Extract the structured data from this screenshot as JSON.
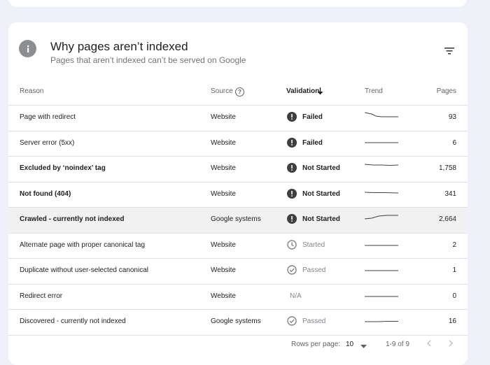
{
  "card": {
    "title": "Why pages aren’t indexed",
    "subtitle": "Pages that aren’t indexed can’t be served on Google"
  },
  "columns": {
    "reason": "Reason",
    "source": "Source",
    "validation": "Validation",
    "trend": "Trend",
    "pages": "Pages"
  },
  "rows": [
    {
      "reason": "Page with redirect",
      "source": "Website",
      "status": "Failed",
      "pages": "93"
    },
    {
      "reason": "Server error (5xx)",
      "source": "Website",
      "status": "Failed",
      "pages": "6"
    },
    {
      "reason": "Excluded by ‘noindex’ tag",
      "source": "Website",
      "status": "Not Started",
      "pages": "1,758"
    },
    {
      "reason": "Not found (404)",
      "source": "Website",
      "status": "Not Started",
      "pages": "341"
    },
    {
      "reason": "Crawled - currently not indexed",
      "source": "Google systems",
      "status": "Not Started",
      "pages": "2,664"
    },
    {
      "reason": "Alternate page with proper canonical tag",
      "source": "Website",
      "status": "Started",
      "pages": "2"
    },
    {
      "reason": "Duplicate without user-selected canonical",
      "source": "Website",
      "status": "Passed",
      "pages": "1"
    },
    {
      "reason": "Redirect error",
      "source": "Website",
      "status": "N/A",
      "pages": "0"
    },
    {
      "reason": "Discovered - currently not indexed",
      "source": "Google systems",
      "status": "Passed",
      "pages": "16"
    }
  ],
  "footer": {
    "rows_per_page_label": "Rows per page:",
    "rows_per_page_value": "10",
    "range": "1-9 of 9"
  },
  "colors": {
    "failed_icon": "#3c4043",
    "muted_icon": "#80868b",
    "trend_line": "#3c4043",
    "highlight_row": "#f1f1f1"
  }
}
